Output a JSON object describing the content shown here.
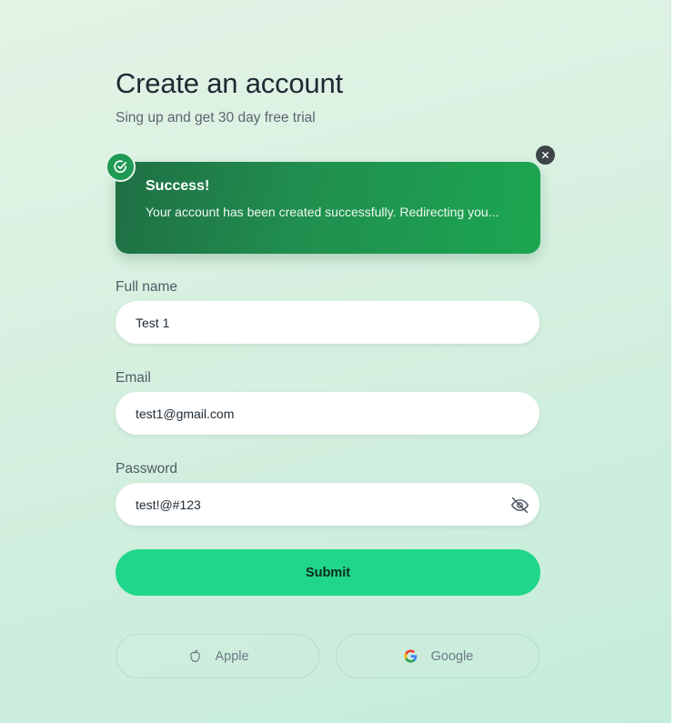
{
  "header": {
    "title": "Create an account",
    "subtitle": "Sing up and get 30 day free trial"
  },
  "toast": {
    "title": "Success!",
    "message": "Your account has been created successfully. Redirecting you...",
    "status_icon": "check-circle-icon",
    "close_icon": "close-icon"
  },
  "form": {
    "fullname": {
      "label": "Full name",
      "value": "Test 1"
    },
    "email": {
      "label": "Email",
      "value": "test1@gmail.com"
    },
    "password": {
      "label": "Password",
      "value": "test!@#123",
      "toggle_icon": "eye-off-icon"
    },
    "submit_label": "Submit"
  },
  "social": {
    "apple": {
      "label": "Apple",
      "icon": "apple-icon"
    },
    "google": {
      "label": "Google",
      "icon": "google-icon"
    }
  },
  "colors": {
    "accent": "#1fd68a",
    "toast_bg": "#208f4f",
    "text_dark": "#1e2a33",
    "text_muted": "#5a6670"
  }
}
